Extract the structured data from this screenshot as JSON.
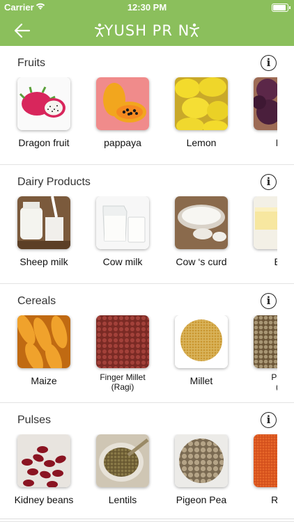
{
  "status_bar": {
    "carrier": "Carrier",
    "time": "12:30 PM"
  },
  "nav": {
    "logo_text": "YUSH PR N"
  },
  "sections": [
    {
      "title": "Fruits",
      "items": [
        "Dragon fruit",
        "pappaya",
        "Lemon",
        "Pl"
      ]
    },
    {
      "title": "Dairy Products",
      "items": [
        "Sheep milk",
        "Cow milk",
        "Cow ‘s curd",
        "Bu"
      ]
    },
    {
      "title": "Cereals",
      "items": [
        "Maize",
        "Finger Millet\n(Ragi)",
        "Millet",
        "Pear\n(B"
      ]
    },
    {
      "title": "Pulses",
      "items": [
        "Kidney beans",
        "Lentils",
        "Pigeon Pea",
        "Red"
      ]
    }
  ],
  "colors": {
    "header_green": "#8bbf5c"
  }
}
